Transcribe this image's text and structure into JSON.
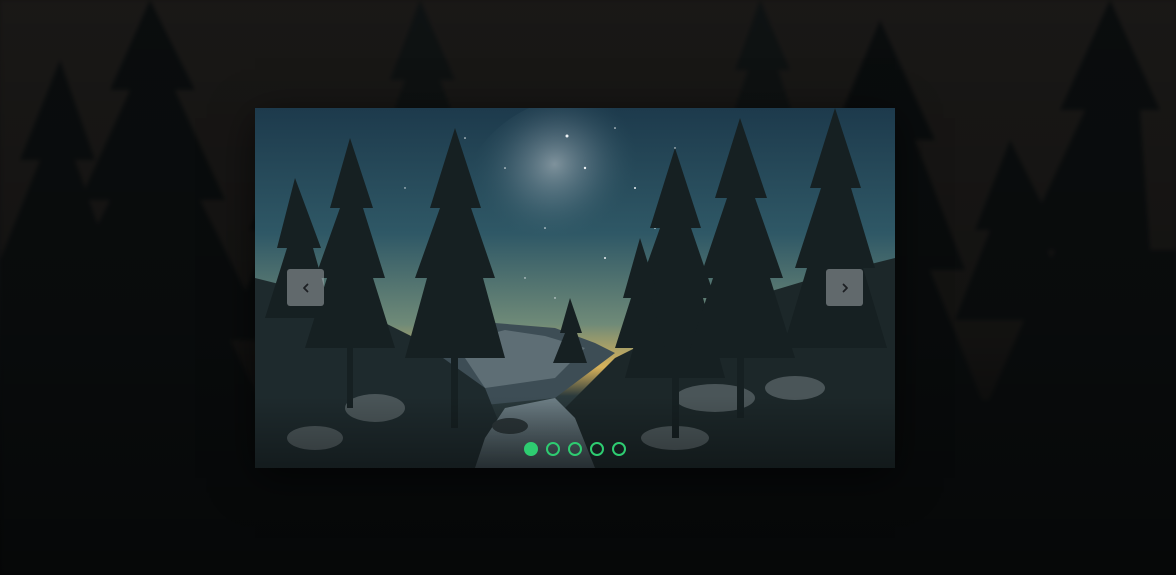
{
  "slider": {
    "slide_count": 5,
    "active_index": 0,
    "image": "night-sky-forest-river"
  },
  "controls": {
    "prev_icon": "chevron-left-icon",
    "next_icon": "chevron-right-icon"
  },
  "colors": {
    "accent": "#2ecc71",
    "nav_button_bg": "#a0a5aa",
    "page_bg": "#0b0e10"
  }
}
